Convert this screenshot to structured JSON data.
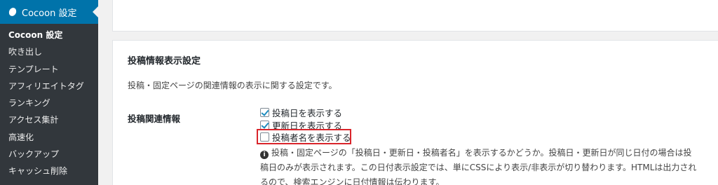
{
  "sidebar": {
    "active_menu_label": "Cocoon 設定",
    "items": [
      {
        "label": "Cocoon 設定",
        "current": true
      },
      {
        "label": "吹き出し"
      },
      {
        "label": "テンプレート"
      },
      {
        "label": "アフィリエイトタグ"
      },
      {
        "label": "ランキング"
      },
      {
        "label": "アクセス集計"
      },
      {
        "label": "高速化"
      },
      {
        "label": "バックアップ"
      },
      {
        "label": "キャッシュ削除"
      }
    ]
  },
  "panel": {
    "title": "投稿情報表示設定",
    "description": "投稿・固定ページの関連情報の表示に関する設定です。",
    "row_label": "投稿関連情報",
    "options": [
      {
        "label": "投稿日を表示する",
        "checked": true
      },
      {
        "label": "更新日を表示する",
        "checked": true
      },
      {
        "label": "投稿者名を表示する",
        "checked": false
      }
    ],
    "note": "投稿・固定ページの「投稿日・更新日・投稿者名」を表示するかどうか。投稿日・更新日が同じ日付の場合は投稿日のみが表示されます。この日付表示設定では、単にCSSにより表示/非表示が切り替わります。HTMLは出力されるので、検索エンジンに日付情報は伝わります。",
    "note_icon": "info-icon"
  },
  "colors": {
    "sidebar_bg": "#23282d",
    "submenu_bg": "#32373c",
    "accent": "#0073aa",
    "highlight": "#d9252b"
  }
}
